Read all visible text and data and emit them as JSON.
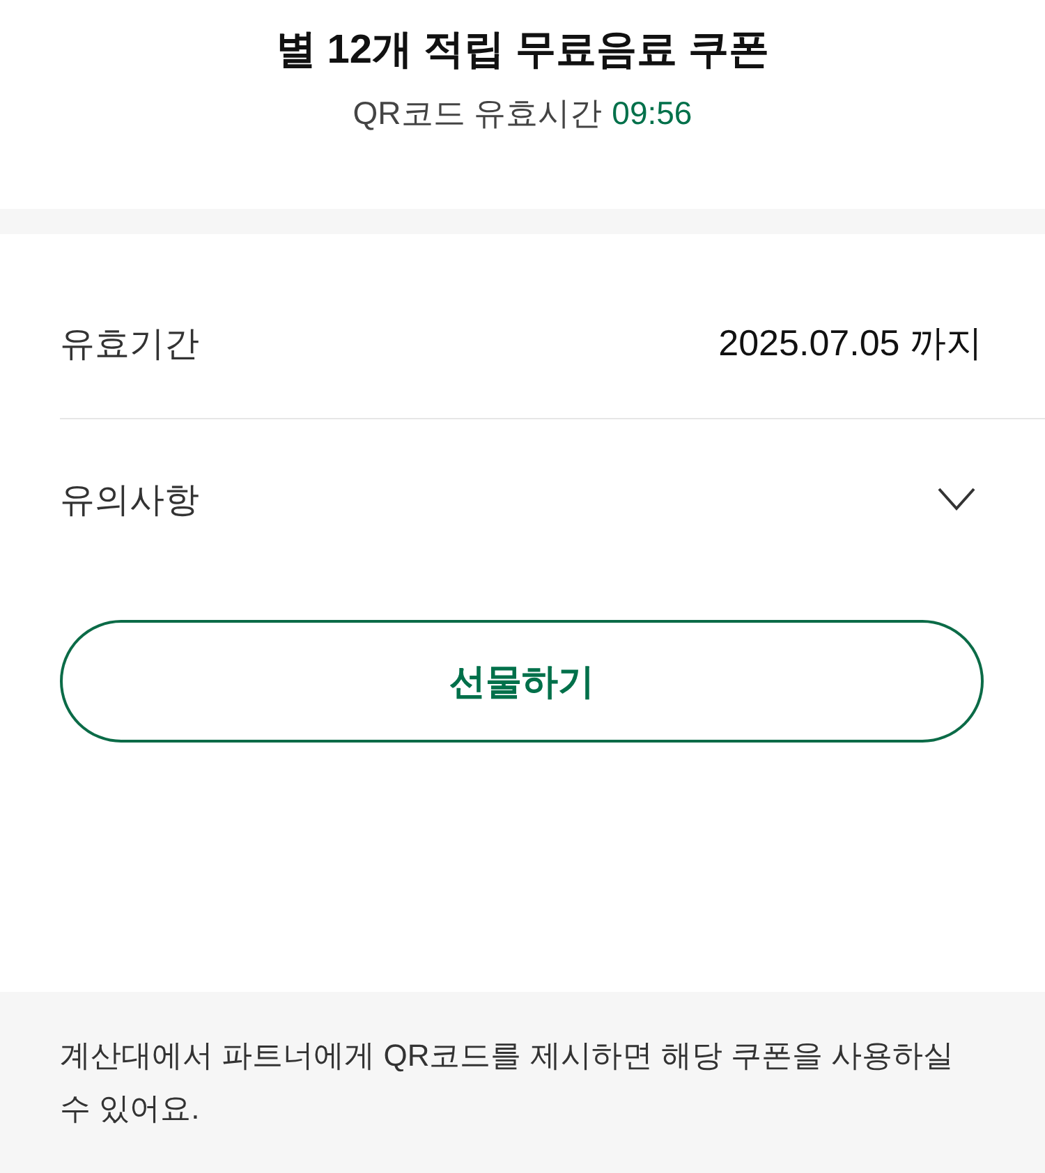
{
  "header": {
    "title": "별 12개 적립 무료음료 쿠폰",
    "qr_validity": {
      "label": "QR코드 유효시간",
      "timer": "09:56"
    }
  },
  "details": [
    {
      "kind": "value",
      "label": "유효기간",
      "value": "2025.07.05 까지"
    },
    {
      "kind": "expandable",
      "label": "유의사항",
      "expanded": false
    }
  ],
  "gift_button": {
    "label": "선물하기"
  },
  "notice": "계산대에서 파트너에게 QR코드를 제시하면 해당 쿠폰을 사용하실 수 있어요."
}
